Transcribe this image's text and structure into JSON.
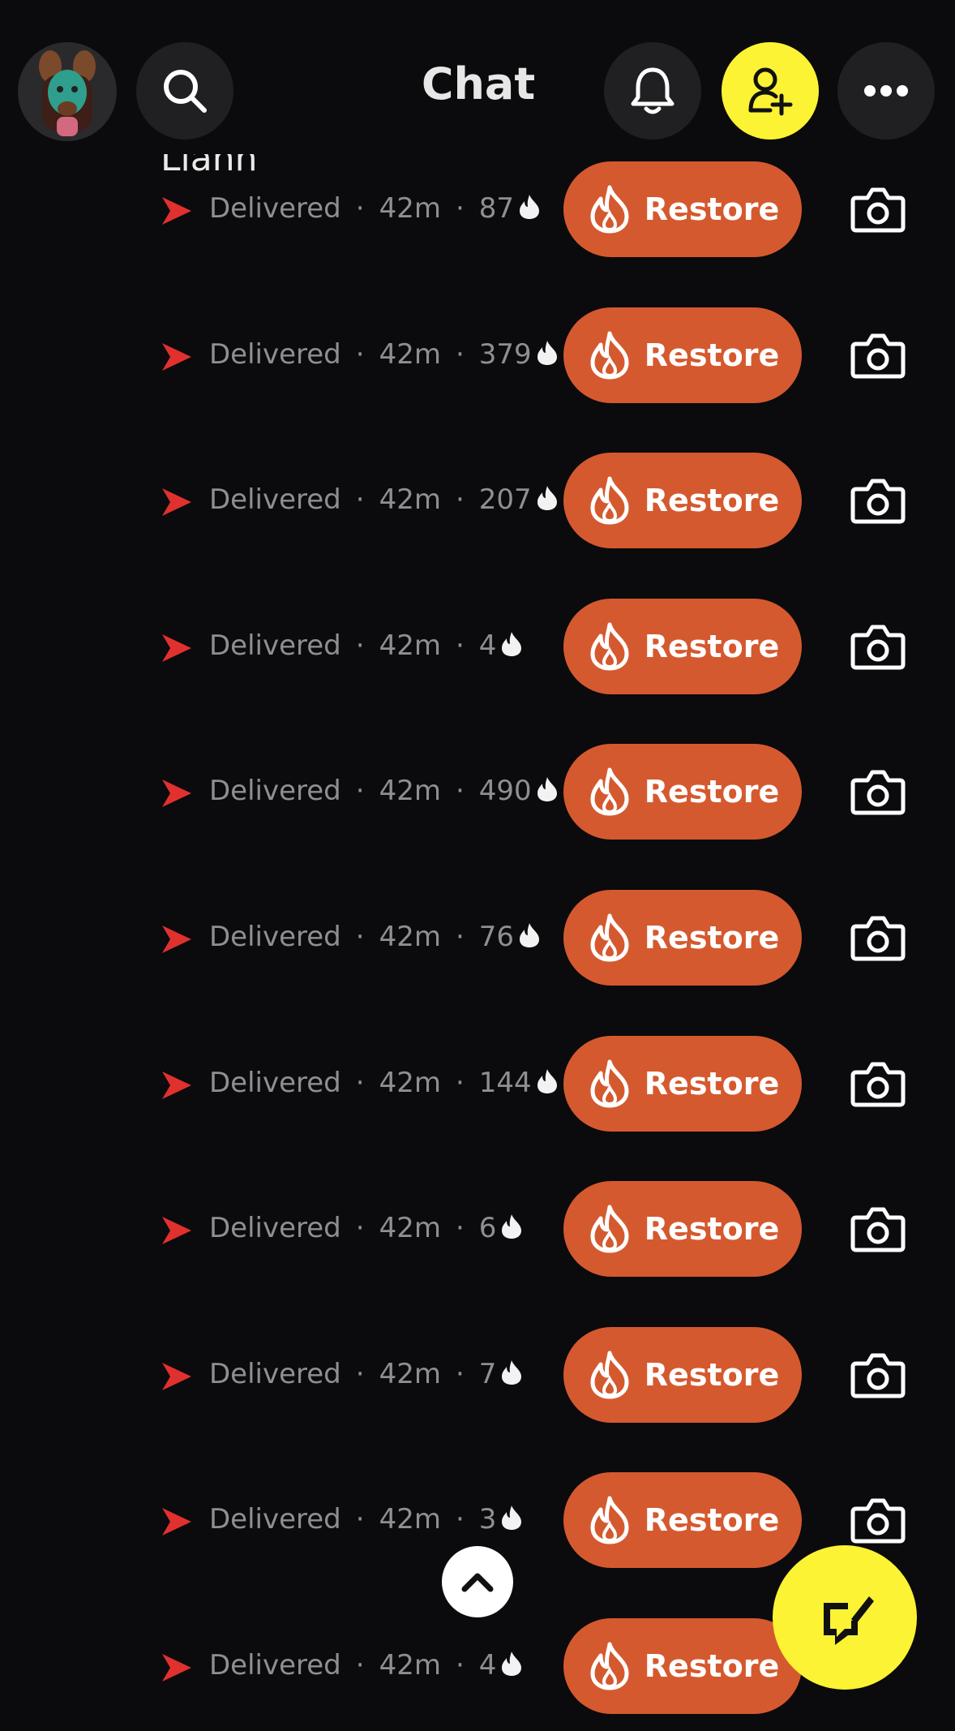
{
  "header": {
    "title": "Chat"
  },
  "peek_name": "Lianh",
  "colors": {
    "restore": "#d5592f",
    "accent_yellow": "#fbf333",
    "delivered_arrow": "#e0312f",
    "background": "#0b0a0c"
  },
  "icons": [
    "search-icon",
    "bell-icon",
    "add-friend-icon",
    "more-icon",
    "flame-icon",
    "camera-icon",
    "chevron-up-icon",
    "compose-icon"
  ],
  "rows": [
    {
      "status": "Delivered",
      "time": "42m",
      "streak": "87",
      "restore_label": "Restore"
    },
    {
      "status": "Delivered",
      "time": "42m",
      "streak": "379",
      "restore_label": "Restore"
    },
    {
      "status": "Delivered",
      "time": "42m",
      "streak": "207",
      "restore_label": "Restore"
    },
    {
      "status": "Delivered",
      "time": "42m",
      "streak": "4",
      "restore_label": "Restore"
    },
    {
      "status": "Delivered",
      "time": "42m",
      "streak": "490",
      "restore_label": "Restore"
    },
    {
      "status": "Delivered",
      "time": "42m",
      "streak": "76",
      "restore_label": "Restore"
    },
    {
      "status": "Delivered",
      "time": "42m",
      "streak": "144",
      "restore_label": "Restore"
    },
    {
      "status": "Delivered",
      "time": "42m",
      "streak": "6",
      "restore_label": "Restore"
    },
    {
      "status": "Delivered",
      "time": "42m",
      "streak": "7",
      "restore_label": "Restore"
    },
    {
      "status": "Delivered",
      "time": "42m",
      "streak": "3",
      "restore_label": "Restore"
    },
    {
      "status": "Delivered",
      "time": "42m",
      "streak": "4",
      "restore_label": "Restore"
    }
  ]
}
